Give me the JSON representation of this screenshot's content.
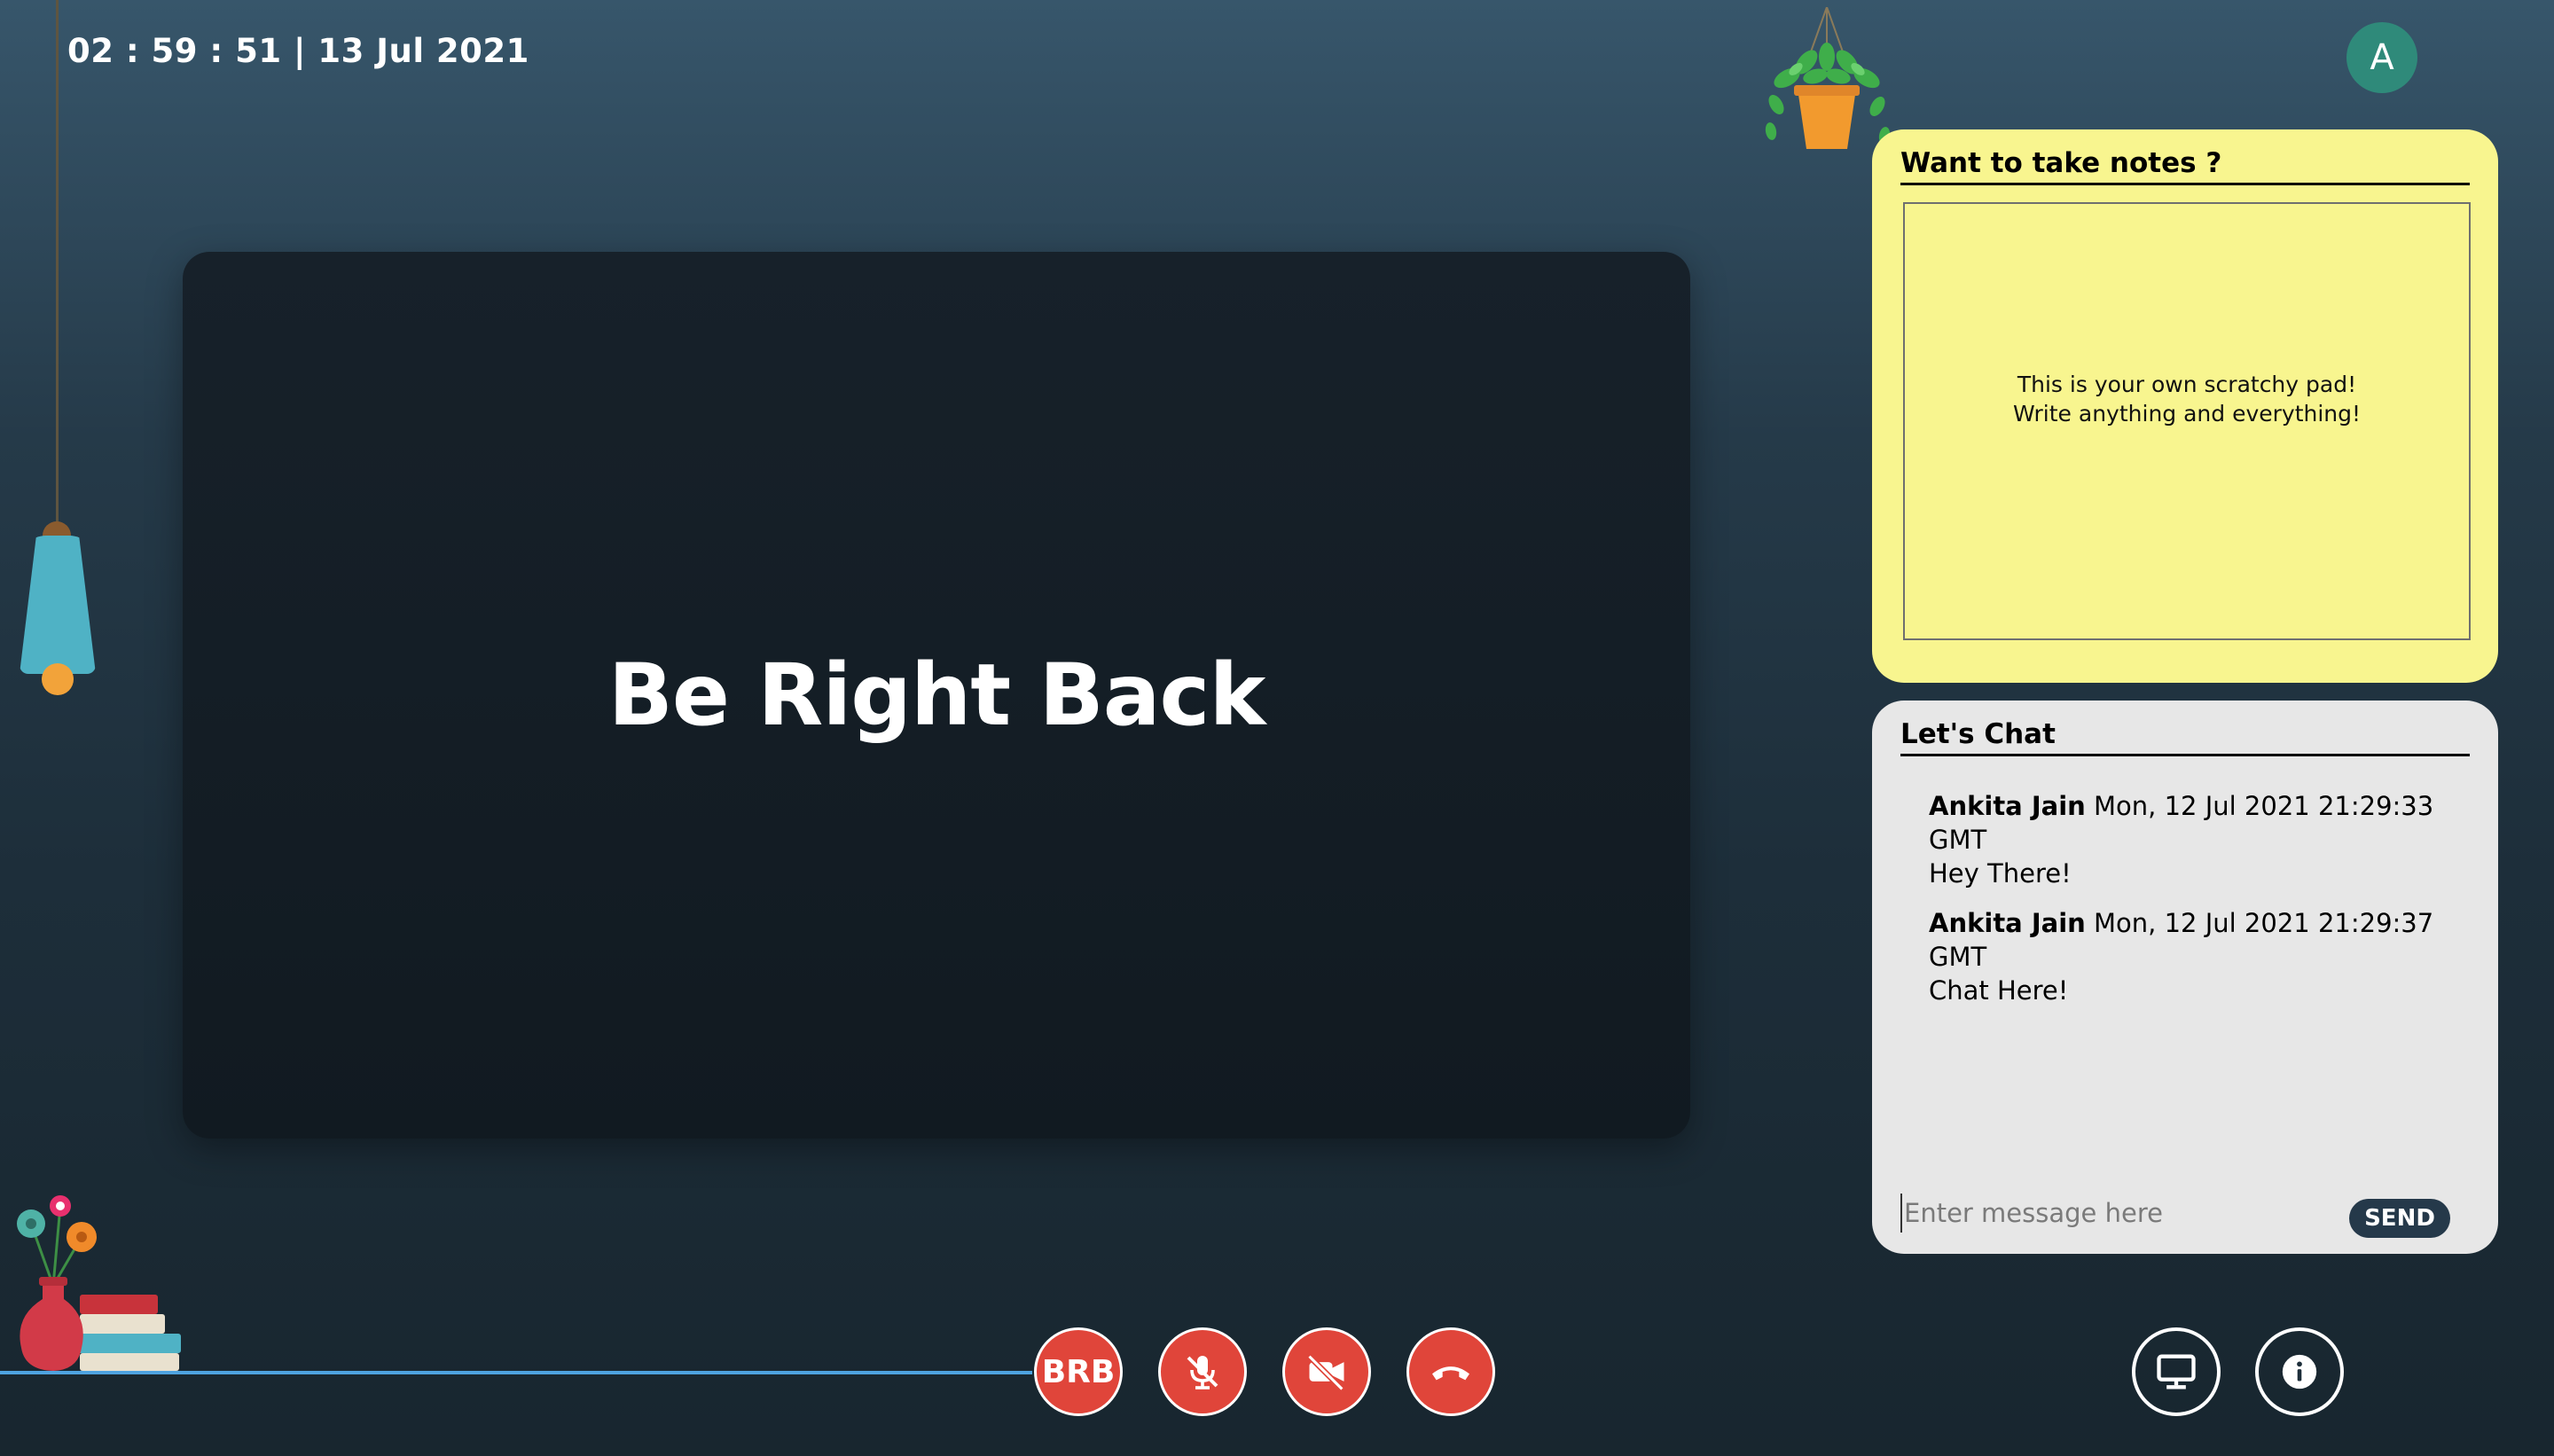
{
  "clock": {
    "text": "02 : 59 : 51 | 13 Jul 2021"
  },
  "user": {
    "avatar_letter": "A"
  },
  "stage": {
    "status_text": "Be Right Back"
  },
  "notes": {
    "title": "Want to take notes ?",
    "placeholder_line1": "This is your own scratchy pad!",
    "placeholder_line2": "Write anything and everything!"
  },
  "chat": {
    "title": "Let's Chat",
    "messages": [
      {
        "sender": "Ankita Jain",
        "timestamp": "Mon, 12 Jul 2021 21:29:33 GMT",
        "text": "Hey There!"
      },
      {
        "sender": "Ankita Jain",
        "timestamp": "Mon, 12 Jul 2021 21:29:37 GMT",
        "text": "Chat Here!"
      }
    ],
    "input_placeholder": "Enter message here",
    "send_label": "SEND"
  },
  "controls": {
    "brb_label": "BRB",
    "mic_icon": "mic-off-icon",
    "camera_icon": "video-off-icon",
    "end_call_icon": "phone-hangup-icon",
    "screen_share_icon": "monitor-icon",
    "info_icon": "info-icon"
  },
  "colors": {
    "accent_red": "#e0453a",
    "notes_yellow": "#f8f58f",
    "chat_gray": "#e7e7e7",
    "send_button": "#25394a",
    "avatar": "#2f8a7a",
    "shelf_line": "#4ea3e0"
  }
}
